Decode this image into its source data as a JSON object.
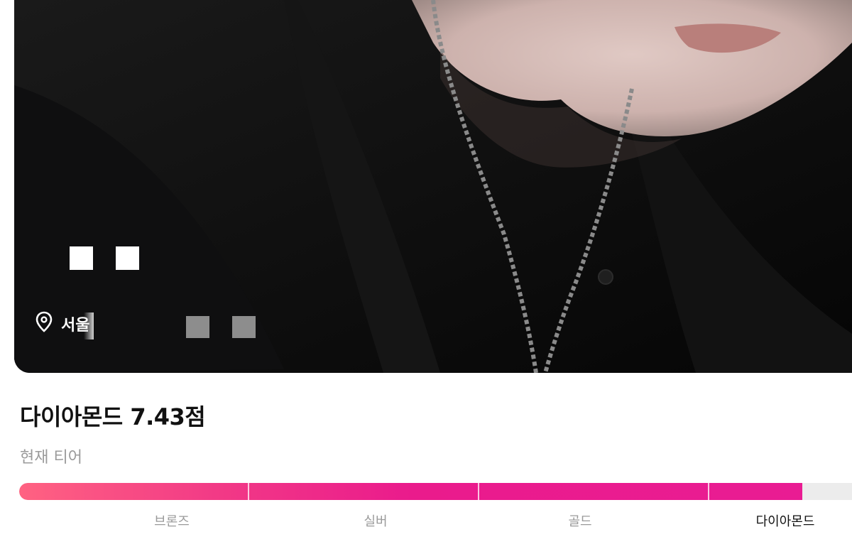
{
  "profile": {
    "location_text": "서울",
    "name_text": ""
  },
  "tier": {
    "title": "다이아몬드 7.43점",
    "subtitle": "현재 티어",
    "progress_fraction": 0.94,
    "labels": [
      "브론즈",
      "실버",
      "골드",
      "다이아몬드"
    ],
    "current_index": 3
  },
  "colors": {
    "accent": "#ea1b8c",
    "accent_start": "#ff6282",
    "track": "#ececec"
  },
  "icons": {
    "location": "map-pin-icon"
  }
}
